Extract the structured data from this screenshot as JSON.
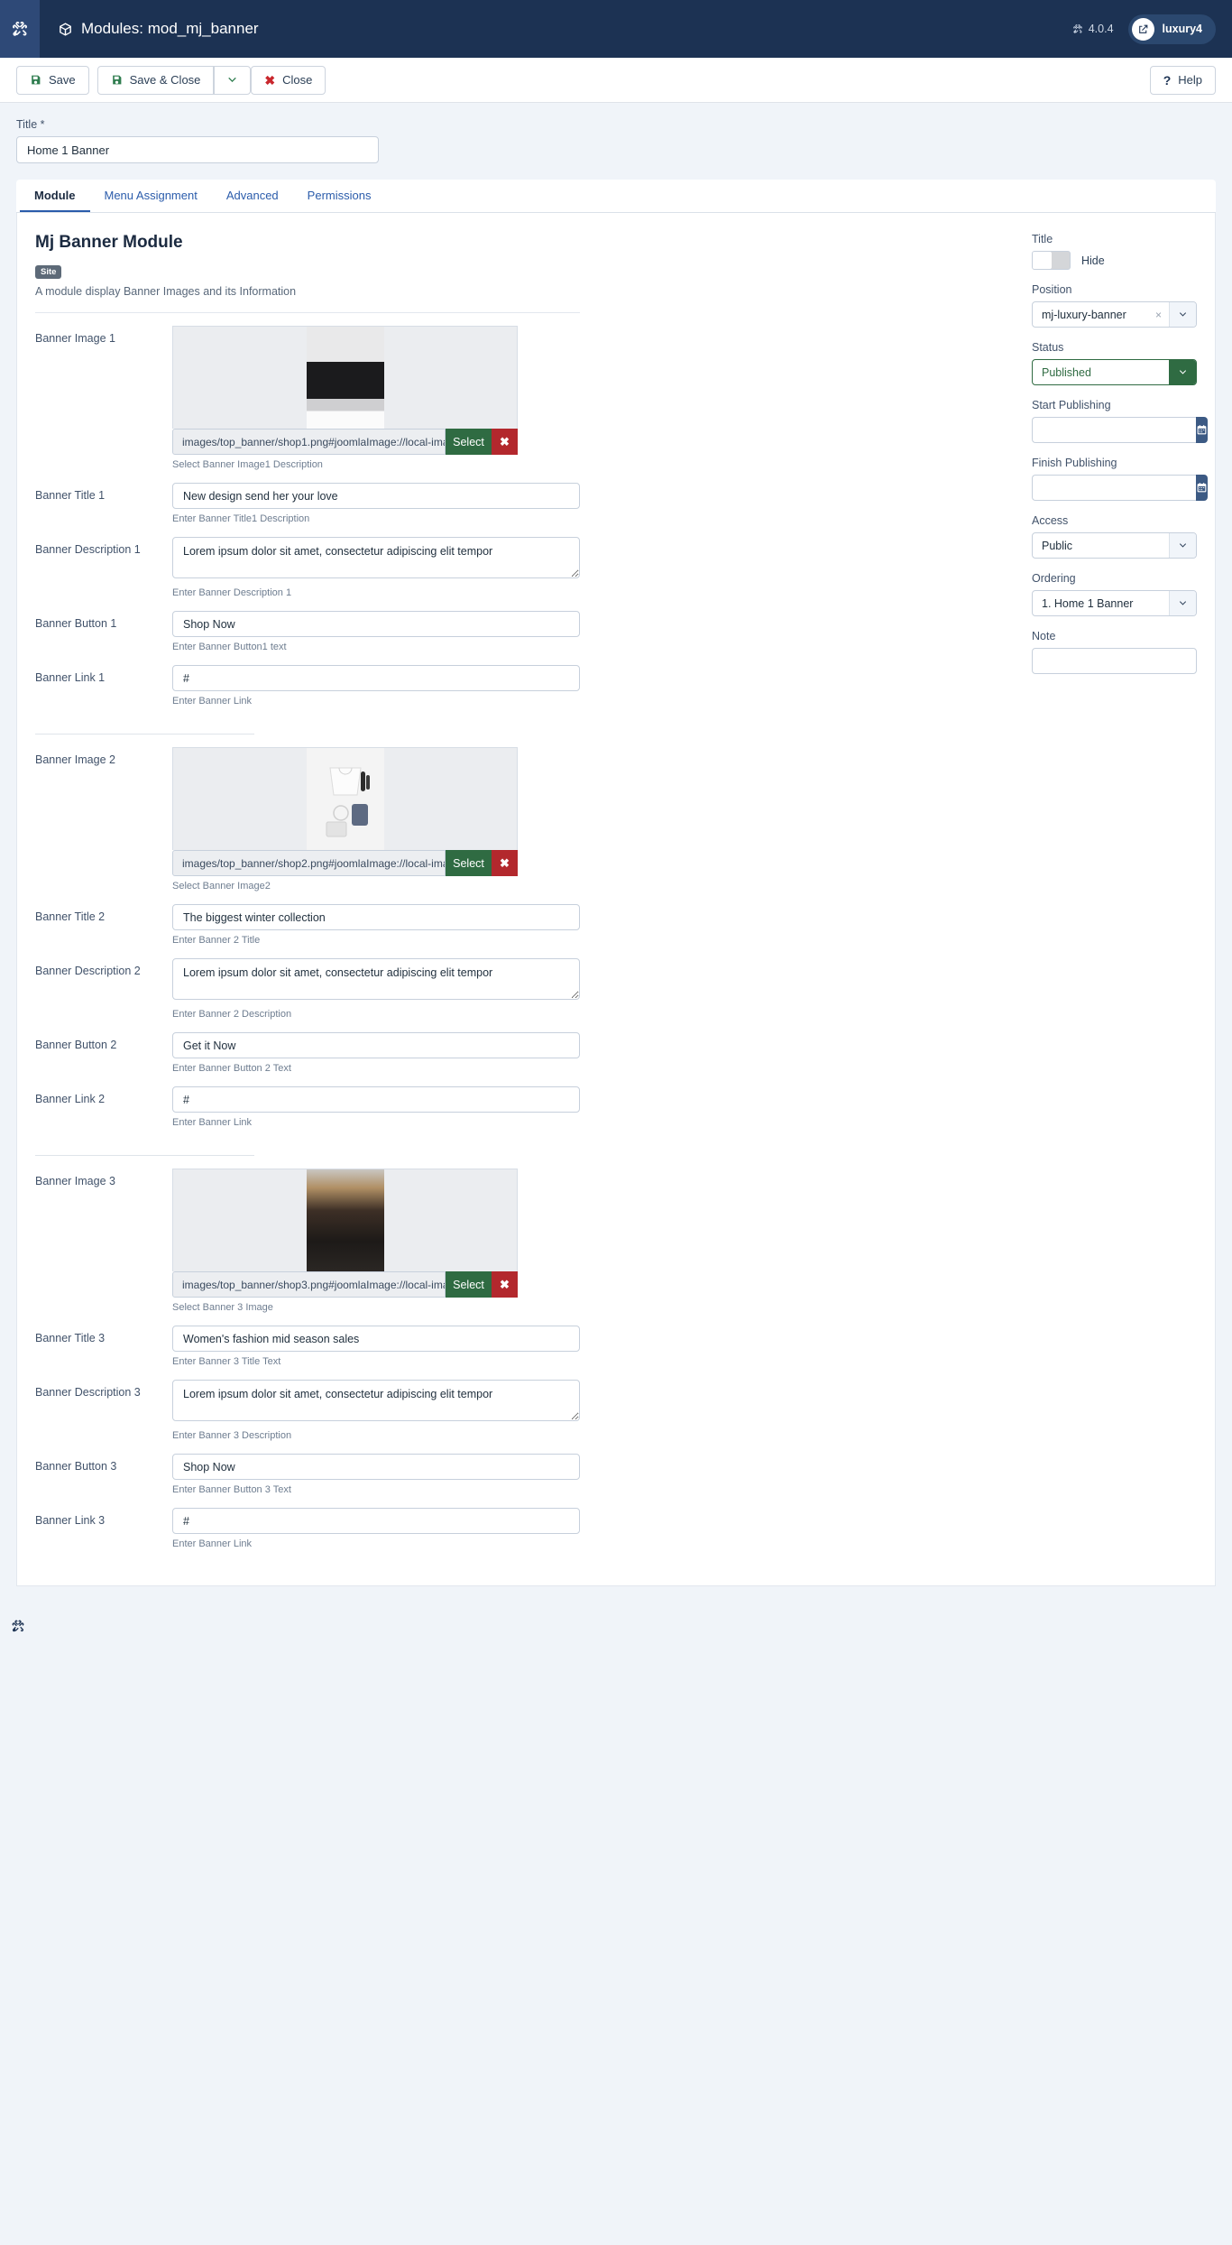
{
  "header": {
    "title": "Modules: mod_mj_banner",
    "version": "4.0.4",
    "site_name": "luxury4",
    "joomla_icon": "joomla-logo-icon",
    "module_icon": "cube-icon",
    "external_link_icon": "external-link-icon"
  },
  "toolbar": {
    "save_label": "Save",
    "save_close_label": "Save & Close",
    "close_label": "Close",
    "help_label": "Help",
    "save_icon": "floppy-disk-icon",
    "caret_icon": "chevron-down-icon",
    "close_icon": "x-icon",
    "help_icon": "question-mark-icon"
  },
  "title_field": {
    "label": "Title *",
    "value": "Home 1 Banner"
  },
  "tabs": [
    {
      "label": "Module",
      "active": true
    },
    {
      "label": "Menu Assignment",
      "active": false
    },
    {
      "label": "Advanced",
      "active": false
    },
    {
      "label": "Permissions",
      "active": false
    }
  ],
  "module": {
    "heading": "Mj Banner Module",
    "badge": "Site",
    "description": "A module display Banner Images and its Information"
  },
  "banners": [
    {
      "image_label": "Banner Image 1",
      "image_path": "images/top_banner/shop1.png#joomlaImage://local-images/top_banner/shop1.png?width=1170&height=500",
      "image_help": "Select Banner Image1 Description",
      "select_label": "Select",
      "clear_label": "✖",
      "title_label": "Banner Title 1",
      "title_value": "New design send her your love",
      "title_help": "Enter Banner Title1 Description",
      "desc_label": "Banner Description 1",
      "desc_value": "Lorem ipsum dolor sit amet, consectetur adipiscing elit tempor",
      "desc_help": "Enter Banner Description 1",
      "button_label": "Banner Button 1",
      "button_value": "Shop Now",
      "button_help": "Enter Banner Button1 text",
      "link_label": "Banner Link 1",
      "link_value": "#",
      "link_help": "Enter Banner Link"
    },
    {
      "image_label": "Banner Image 2",
      "image_path": "images/top_banner/shop2.png#joomlaImage://local-images/top_banner/shop2.png?width=1170&height=500",
      "image_help": "Select Banner Image2",
      "select_label": "Select",
      "clear_label": "✖",
      "title_label": "Banner Title 2",
      "title_value": "The biggest winter collection",
      "title_help": "Enter Banner 2 Title",
      "desc_label": "Banner Description 2",
      "desc_value": "Lorem ipsum dolor sit amet, consectetur adipiscing elit tempor",
      "desc_help": "Enter Banner 2 Description",
      "button_label": "Banner Button 2",
      "button_value": "Get it Now",
      "button_help": "Enter Banner Button 2 Text",
      "link_label": "Banner Link 2",
      "link_value": "#",
      "link_help": "Enter Banner Link"
    },
    {
      "image_label": "Banner Image 3",
      "image_path": "images/top_banner/shop3.png#joomlaImage://local-images/top_banner/shop3.png?width=1170&height=500",
      "image_help": "Select Banner 3 Image",
      "select_label": "Select",
      "clear_label": "✖",
      "title_label": "Banner Title 3",
      "title_value": "Women's fashion mid season sales",
      "title_help": "Enter Banner 3 Title Text",
      "desc_label": "Banner Description 3",
      "desc_value": "Lorem ipsum dolor sit amet, consectetur adipiscing elit tempor",
      "desc_help": "Enter Banner 3 Description",
      "button_label": "Banner Button 3",
      "button_value": "Shop Now",
      "button_help": "Enter Banner Button 3 Text",
      "link_label": "Banner Link 3",
      "link_value": "#",
      "link_help": "Enter Banner Link"
    }
  ],
  "sidebar": {
    "title_show": {
      "label": "Title",
      "toggle_state": "Hide"
    },
    "position": {
      "label": "Position",
      "value": "mj-luxury-banner",
      "clear": "×"
    },
    "status": {
      "label": "Status",
      "value": "Published"
    },
    "start_publishing": {
      "label": "Start Publishing",
      "value": ""
    },
    "finish_publishing": {
      "label": "Finish Publishing",
      "value": ""
    },
    "access": {
      "label": "Access",
      "value": "Public"
    },
    "ordering": {
      "label": "Ordering",
      "value": "1. Home 1 Banner"
    },
    "note": {
      "label": "Note",
      "value": ""
    }
  },
  "colors": {
    "header_bg": "#1c3253",
    "brand_bg": "#2e4977",
    "accent_green": "#2f6b42",
    "accent_red": "#b3282d",
    "accent_blue": "#3c5a84",
    "link_blue": "#2b5cab"
  }
}
